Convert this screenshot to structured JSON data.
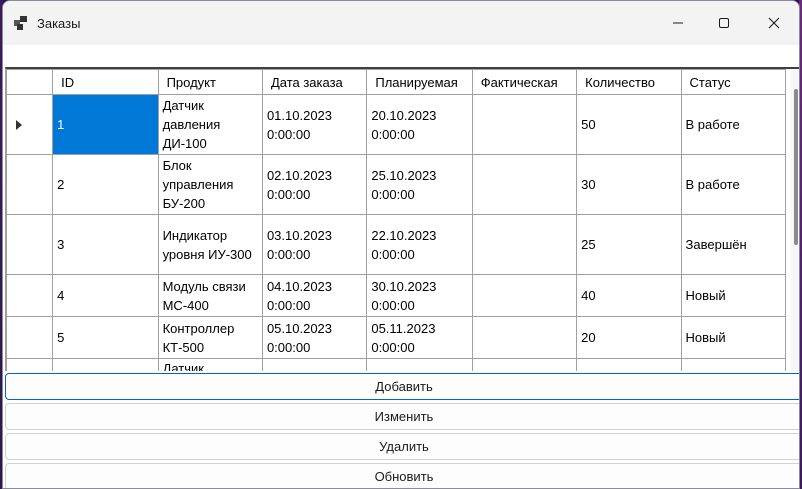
{
  "window": {
    "title": "Заказы",
    "icon": "app-window-icon"
  },
  "grid": {
    "columns": [
      "ID",
      "Продукт",
      "Дата заказа",
      "Планируемая",
      "Фактическая",
      "Количество",
      "Статус"
    ],
    "rows": [
      {
        "id": "1",
        "product": "Датчик давления ДИ-100",
        "order_date": "01.10.2023 0:00:00",
        "planned": "20.10.2023 0:00:00",
        "actual": "",
        "quantity": "50",
        "status": "В работе"
      },
      {
        "id": "2",
        "product": "Блок управления БУ-200",
        "order_date": "02.10.2023 0:00:00",
        "planned": "25.10.2023 0:00:00",
        "actual": "",
        "quantity": "30",
        "status": "В работе"
      },
      {
        "id": "3",
        "product": "Индикатор уровня ИУ-300",
        "order_date": "03.10.2023 0:00:00",
        "planned": "22.10.2023 0:00:00",
        "actual": "",
        "quantity": "25",
        "status": "Завершён"
      },
      {
        "id": "4",
        "product": "Модуль связи МС-400",
        "order_date": "04.10.2023 0:00:00",
        "planned": "30.10.2023 0:00:00",
        "actual": "",
        "quantity": "40",
        "status": "Новый"
      },
      {
        "id": "5",
        "product": "Контроллер КТ-500",
        "order_date": "05.10.2023 0:00:00",
        "planned": "05.11.2023 0:00:00",
        "actual": "",
        "quantity": "20",
        "status": "Новый"
      },
      {
        "product": "Датчик"
      }
    ]
  },
  "buttons": {
    "add": "Добавить",
    "edit": "Изменить",
    "delete": "Удалить",
    "refresh": "Обновить"
  }
}
